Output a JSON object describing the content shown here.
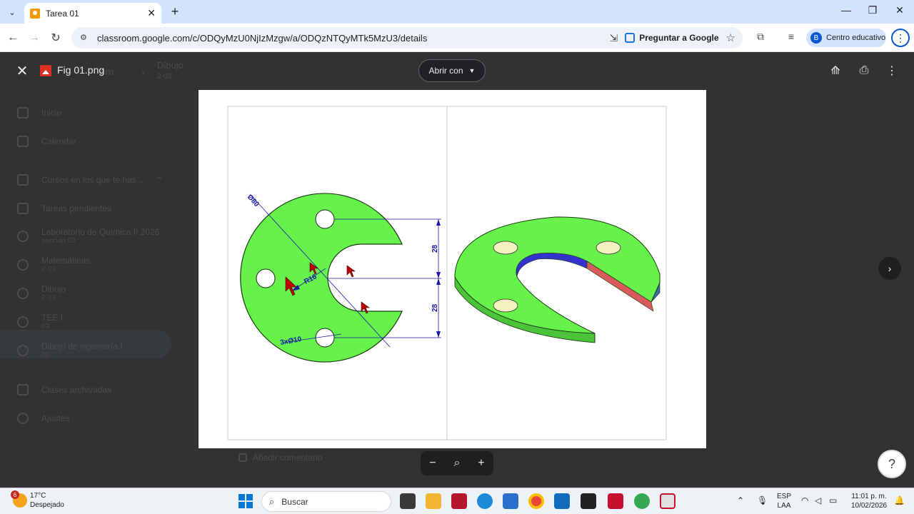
{
  "browser": {
    "tab_title": "Tarea 01",
    "url": "classroom.google.com/c/ODQyMzU0NjIzMzgw/a/ODQzNTQyMTk5MzU3/details",
    "ask_google": "Preguntar a Google",
    "profile_initial": "B",
    "profile_label": "Centro educativo"
  },
  "background_page": {
    "breadcrumb_course": "Dibujo",
    "breadcrumb_sub": "2-03",
    "sidebar": [
      {
        "label": "Inicio",
        "sub": ""
      },
      {
        "label": "Calendar",
        "sub": ""
      },
      {
        "label": "Cursos en los que te has ...",
        "sub": ""
      },
      {
        "label": "Tareas pendientes",
        "sub": ""
      },
      {
        "label": "Laboratorio de Química II 2026",
        "sub": "sección 03"
      },
      {
        "label": "Matemáticas",
        "sub": "2-03"
      },
      {
        "label": "Dibujo",
        "sub": "2-03"
      },
      {
        "label": "TEE I",
        "sub": "03"
      },
      {
        "label": "Dibujo de ingeniería I",
        "sub": "03"
      },
      {
        "label": "Clases archivadas",
        "sub": ""
      },
      {
        "label": "Ajustes",
        "sub": ""
      }
    ],
    "comment_placeholder": "Añadir comentario"
  },
  "viewer": {
    "file_name": "Fig 01.png",
    "open_with": "Abrir con"
  },
  "drawing": {
    "dim_diameter": "Ø80",
    "dim_radius": "R16",
    "dim_holes": "3xØ10",
    "dim_upper": "28",
    "dim_lower": "28",
    "colors": {
      "part_fill": "#66f24a",
      "dimension": "#1a1aa8",
      "slot_inner": "#3333cc",
      "cut_face": "#d95a5a",
      "arrow": "#c00000"
    }
  },
  "taskbar": {
    "weather_badge": "6",
    "temperature": "17°C",
    "condition": "Despejado",
    "search_label": "Buscar",
    "lang_line1": "ESP",
    "lang_line2": "LAA",
    "time": "11:01 p. m.",
    "date": "10/02/2026"
  }
}
